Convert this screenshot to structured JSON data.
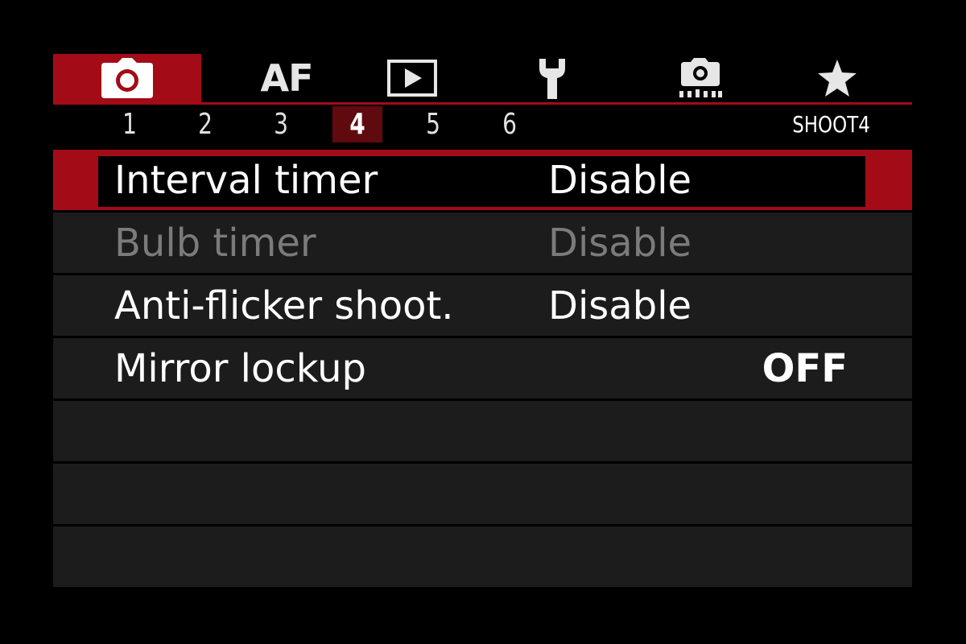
{
  "tabs": [
    {
      "id": "shooting",
      "icon": "camera-icon",
      "active": true
    },
    {
      "id": "af",
      "label": "AF",
      "active": false
    },
    {
      "id": "playback",
      "icon": "playback-icon",
      "active": false
    },
    {
      "id": "setup",
      "icon": "wrench-icon",
      "active": false
    },
    {
      "id": "custom",
      "icon": "custom-camera-icon",
      "active": false
    },
    {
      "id": "mymenu",
      "icon": "star-icon",
      "active": false
    }
  ],
  "subtabs": [
    "1",
    "2",
    "3",
    "4",
    "5",
    "6"
  ],
  "active_subtab": "4",
  "page_id": "SHOOT4",
  "menu_items": [
    {
      "label": "Interval timer",
      "value": "Disable",
      "selected": true,
      "disabled": false
    },
    {
      "label": "Bulb timer",
      "value": "Disable",
      "selected": false,
      "disabled": true
    },
    {
      "label": "Anti-flicker shoot.",
      "value": "Disable",
      "selected": false,
      "disabled": false
    },
    {
      "label": "Mirror lockup",
      "value": "OFF",
      "selected": false,
      "disabled": false
    }
  ],
  "colors": {
    "accent": "#a30b16",
    "active_subtab": "#5e0a0f",
    "row_bg": "#1c1c1c",
    "disabled_text": "#7b7b7b"
  }
}
